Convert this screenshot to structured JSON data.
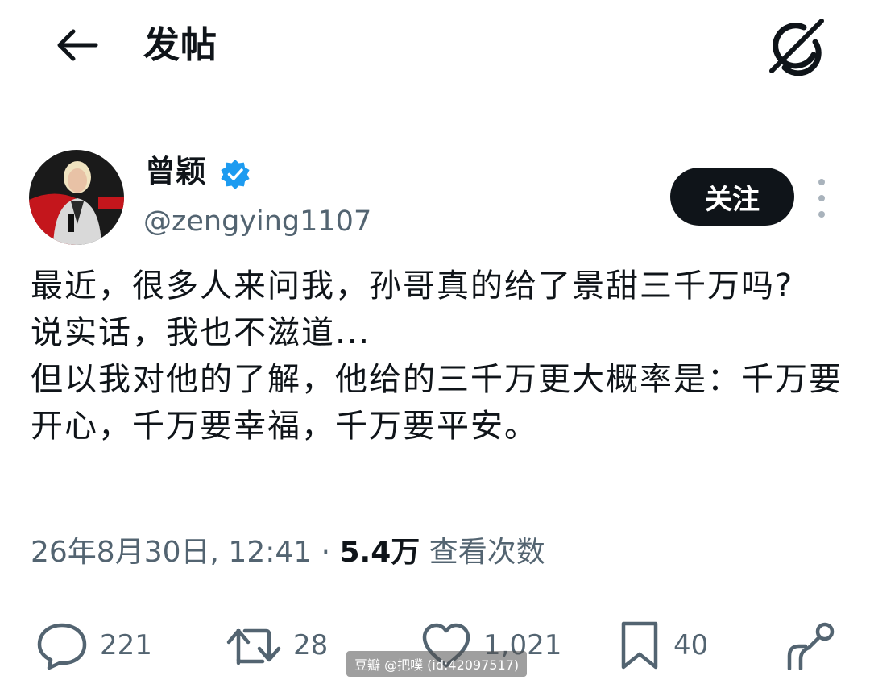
{
  "header": {
    "title": "发帖",
    "back_icon": "arrow-left-icon",
    "grok_icon": "grok-icon"
  },
  "author": {
    "name": "曾颖",
    "handle": "@zengying1107",
    "verified": true,
    "verified_color": "#1d9bf0",
    "avatar_icon": "avatar-photo",
    "follow_label": "关注"
  },
  "post": {
    "text": "最近，很多人来问我，孙哥真的给了景甜三千万吗?\n说实话，我也不滋道...\n但以我对他的了解，他给的三千万更大概率是：千万要开心，千万要幸福，千万要平安。"
  },
  "meta": {
    "datetime": "26年8月30日, 12:41",
    "separator": " · ",
    "views_count": "5.4万",
    "views_label": " 查看次数"
  },
  "actions": {
    "reply_count": "221",
    "repost_count": "28",
    "like_count": "1,021",
    "bookmark_count": "40"
  },
  "watermark": "豆瓣 @把噗 (id:42097517)",
  "colors": {
    "text": "#0f1419",
    "secondary": "#536471",
    "follow_bg": "#0f1419"
  }
}
